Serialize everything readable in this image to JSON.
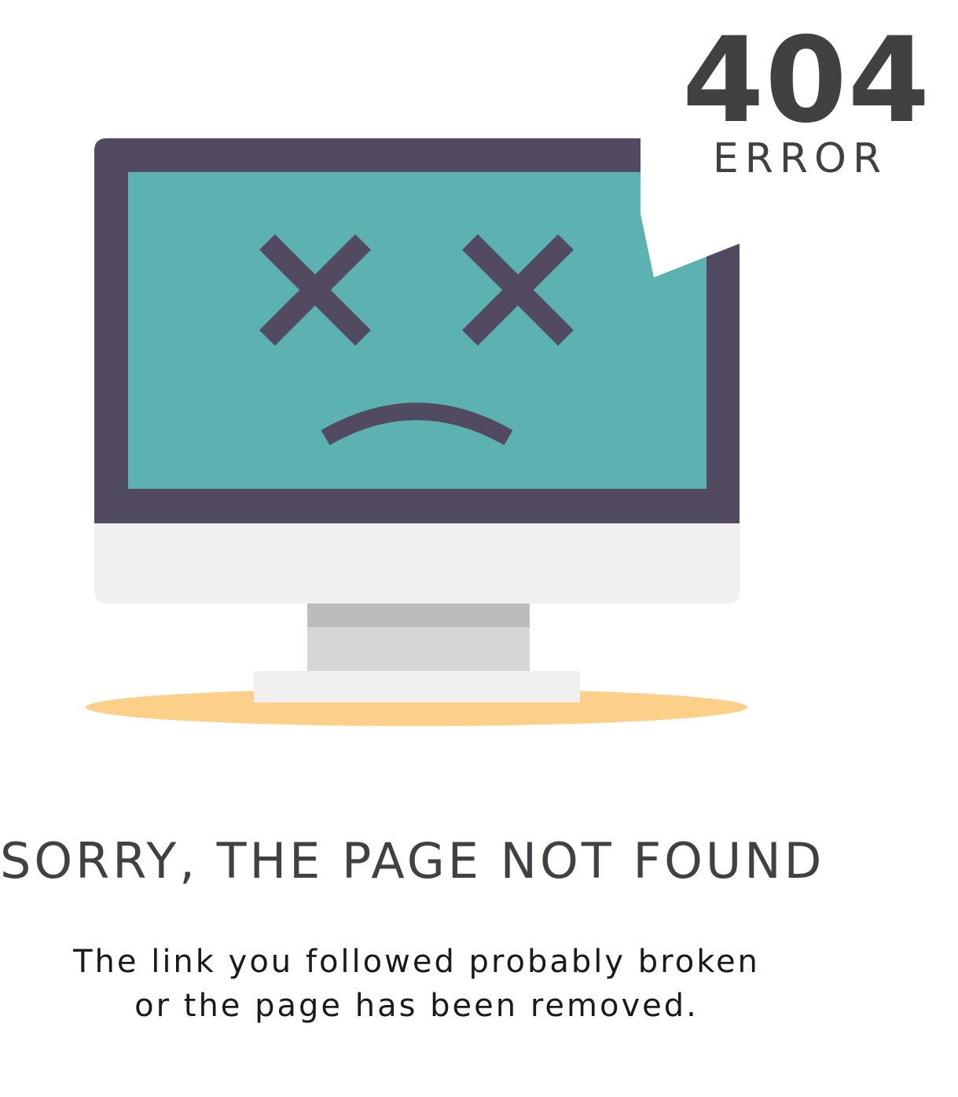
{
  "illustration": {
    "icon": "broken-computer-icon",
    "colors": {
      "bezel": "#524a61",
      "screen": "#5cb2b1",
      "chin": "#f0f0f0",
      "stand_top": "#bcbcbc",
      "stand": "#d6d6d6",
      "base": "#f0f0f0",
      "shadow": "#fdd08a",
      "face": "#524a61"
    }
  },
  "error_badge": {
    "code": "404",
    "label": "ERROR"
  },
  "headline": "SORRY, THE PAGE NOT FOUND",
  "message": {
    "line1": "The link you followed probably broken",
    "line2": "or the page has been removed."
  }
}
